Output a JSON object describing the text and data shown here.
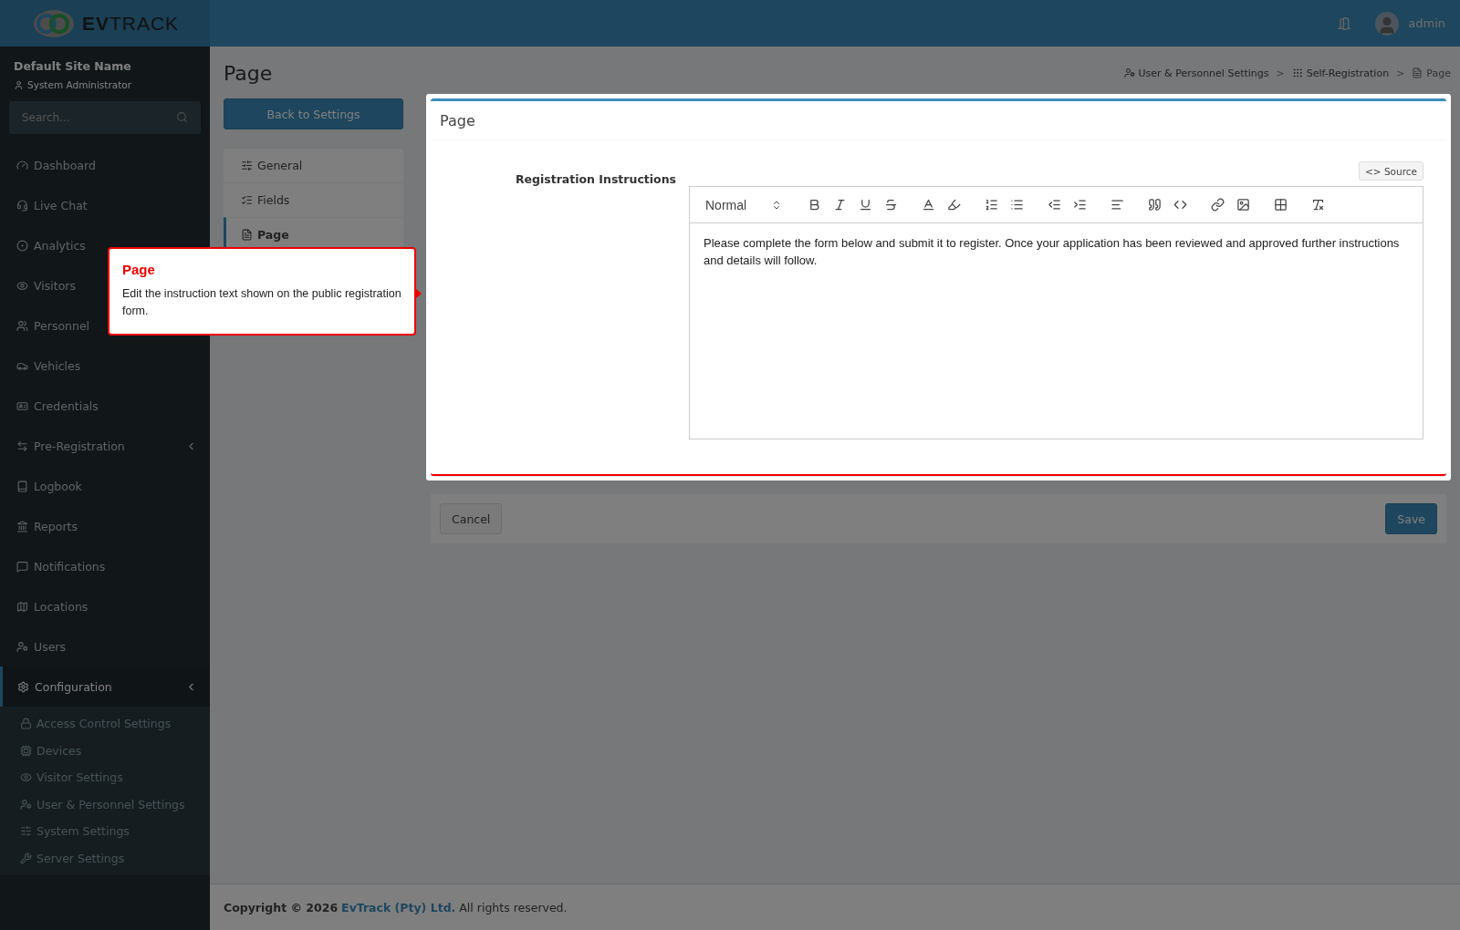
{
  "brand": {
    "logo_text": "**EV**TRACK"
  },
  "topbar": {
    "user": "admin"
  },
  "sidebar": {
    "site_name": "Default Site Name",
    "role": "System Administrator",
    "search": {
      "placeholder": "Search..."
    },
    "items": [
      {
        "label": "Dashboard",
        "selected": false
      },
      {
        "label": "Live Chat",
        "selected": false
      },
      {
        "label": "Analytics",
        "selected": false
      },
      {
        "label": "Visitors",
        "selected": false
      },
      {
        "label": "Personnel",
        "selected": false
      },
      {
        "label": "Vehicles",
        "selected": false
      },
      {
        "label": "Credentials",
        "selected": false
      },
      {
        "label": "Pre-Registration",
        "selected": false,
        "has_submenu": true
      },
      {
        "label": "Logbook",
        "selected": false
      },
      {
        "label": "Reports",
        "selected": false
      },
      {
        "label": "Notifications",
        "selected": false
      },
      {
        "label": "Locations",
        "selected": false
      },
      {
        "label": "Users",
        "selected": false
      },
      {
        "label": "Configuration",
        "selected": true,
        "has_submenu": true,
        "children": [
          {
            "label": "Access Control Settings",
            "selected": false
          },
          {
            "label": "Devices",
            "selected": false
          },
          {
            "label": "Visitor Settings",
            "selected": false
          },
          {
            "label": "User & Personnel Settings",
            "selected": false
          },
          {
            "label": "System Settings",
            "selected": false
          },
          {
            "label": "Server Settings",
            "selected": false
          }
        ]
      }
    ]
  },
  "page": {
    "title": "Page",
    "breadcrumb": [
      "User & Personnel Settings",
      "Self-Registration",
      "Page"
    ],
    "breadcrumb_separator": ">",
    "back_button": "Back to Settings",
    "settings_menu": [
      {
        "label": "General",
        "selected": false
      },
      {
        "label": "Fields",
        "selected": false
      },
      {
        "label": "Page",
        "selected": true
      }
    ],
    "card": {
      "title": "Page",
      "field_label": "Registration Instructions",
      "source_button": "<> Source",
      "editor": {
        "format": "Normal",
        "content": "Please complete the form below and submit it to register. Once your application has been reviewed and approved further instructions and details will follow."
      }
    },
    "actions": {
      "cancel": "Cancel",
      "save": "Save"
    }
  },
  "tour": {
    "title": "Page",
    "text": "Edit the instruction text shown on the public registration form."
  },
  "footer": {
    "prefix": "Copyright © 2026",
    "link": "EvTrack (Pty) Ltd.",
    "suffix": "All rights reserved."
  }
}
